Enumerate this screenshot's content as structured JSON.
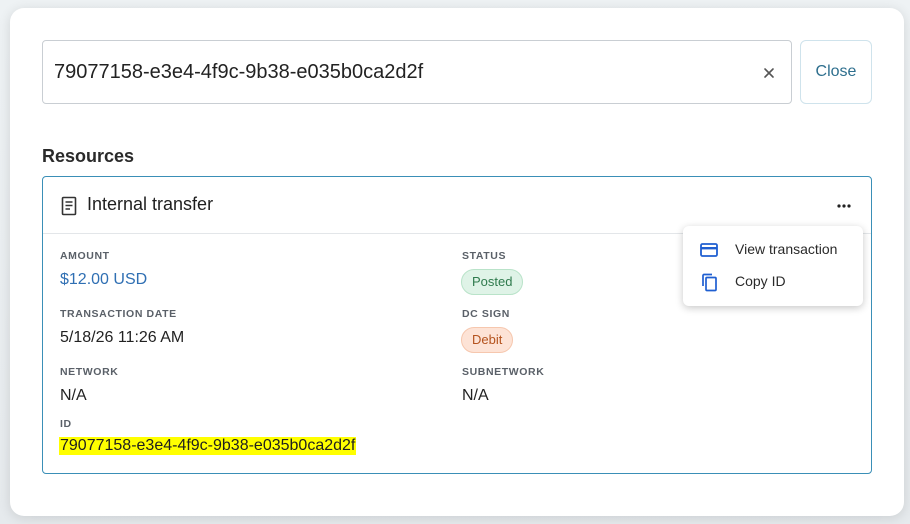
{
  "search": {
    "value": "79077158-e3e4-4f9c-9b38-e035b0ca2d2f",
    "clear_icon": "close-icon"
  },
  "close_button": {
    "label": "Close"
  },
  "section": {
    "title": "Resources"
  },
  "card": {
    "icon": "document-icon",
    "title": "Internal transfer",
    "more_icon": "more-horizontal-icon",
    "fields": {
      "amount": {
        "label": "AMOUNT",
        "value": "$12.00 USD"
      },
      "status": {
        "label": "STATUS",
        "value": "Posted"
      },
      "transaction_date": {
        "label": "TRANSACTION DATE",
        "value": "5/18/26 11:26 AM"
      },
      "dc_sign": {
        "label": "DC SIGN",
        "value": "Debit"
      },
      "network": {
        "label": "NETWORK",
        "value": "N/A"
      },
      "subnetwork": {
        "label": "SUBNETWORK",
        "value": "N/A"
      },
      "id": {
        "label": "ID",
        "value": "79077158-e3e4-4f9c-9b38-e035b0ca2d2f"
      }
    }
  },
  "menu": {
    "items": [
      {
        "label": "View transaction",
        "icon": "credit-card-icon"
      },
      {
        "label": "Copy ID",
        "icon": "copy-icon"
      }
    ]
  },
  "colors": {
    "accent": "#2f6fb3",
    "card_border": "#3a8fb7",
    "highlight": "#ffff00",
    "posted_bg": "#dff3e7",
    "debit_bg": "#fde3d6"
  }
}
